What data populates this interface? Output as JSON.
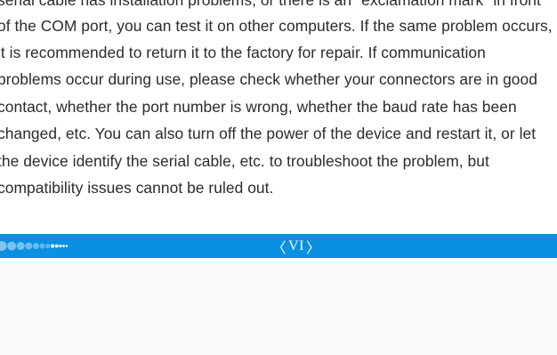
{
  "document": {
    "paragraph_lines": [
      "serial cable has installation problems, or there is an \"exclamation mark\" in front",
      "of the COM port, you can test it on other computers. If the same problem occurs,",
      "it is recommended to return it to the factory for repair. If communication",
      "problems occur during use, please check whether your connectors are in good",
      "contact, whether the port number is wrong, whether the baud rate has been",
      "changed, etc. You can also turn off the power of the device and restart it, or let",
      "the device identify the serial cable, etc. to troubleshoot the problem, but",
      "compatibility issues cannot be ruled out."
    ]
  },
  "footer": {
    "page_number": "VI",
    "left_chevron": "〈",
    "right_chevron": "〉",
    "bar_color": "#0b8fe0",
    "dot_color": "#7fc6f3"
  }
}
